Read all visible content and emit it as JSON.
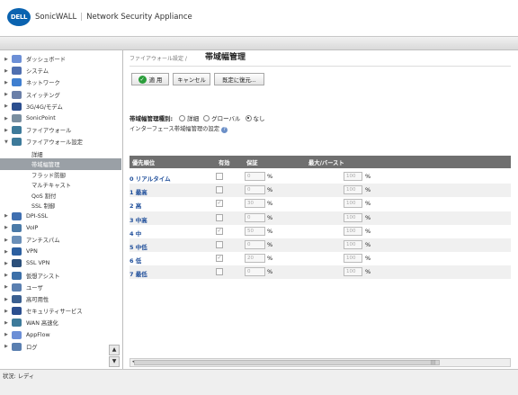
{
  "header": {
    "brand_name": "SonicWALL",
    "product_name": "Network Security Appliance",
    "logo_text": "DELL"
  },
  "sidebar": {
    "items": [
      {
        "label": "ダッシュボード",
        "icon": "dashboard-icon"
      },
      {
        "label": "システム",
        "icon": "system-icon"
      },
      {
        "label": "ネットワーク",
        "icon": "network-icon"
      },
      {
        "label": "スイッチング",
        "icon": "switching-icon"
      },
      {
        "label": "3G/4G/モデム",
        "icon": "modem-icon"
      },
      {
        "label": "SonicPoint",
        "icon": "sonicpoint-icon"
      },
      {
        "label": "ファイアウォール",
        "icon": "firewall-icon"
      },
      {
        "label": "ファイアウォール設定",
        "icon": "firewall-settings-icon"
      }
    ],
    "subitems": [
      "詳細",
      "帯域幅管理",
      "フラッド防御",
      "マルチキャスト",
      "QoS 割付",
      "SSL 制御"
    ],
    "items_after": [
      {
        "label": "DPI-SSL",
        "icon": "dpi-ssl-icon"
      },
      {
        "label": "VoIP",
        "icon": "voip-icon"
      },
      {
        "label": "アンチスパム",
        "icon": "antispam-icon"
      },
      {
        "label": "VPN",
        "icon": "vpn-icon"
      },
      {
        "label": "SSL VPN",
        "icon": "ssl-vpn-icon"
      },
      {
        "label": "仮想アシスト",
        "icon": "virtual-assist-icon"
      },
      {
        "label": "ユーザ",
        "icon": "users-icon"
      },
      {
        "label": "高可用性",
        "icon": "high-availability-icon"
      },
      {
        "label": "セキュリティサービス",
        "icon": "security-services-icon"
      },
      {
        "label": "WAN 高速化",
        "icon": "wan-acceleration-icon"
      },
      {
        "label": "AppFlow",
        "icon": "appflow-icon"
      },
      {
        "label": "ログ",
        "icon": "log-icon"
      }
    ]
  },
  "main": {
    "breadcrumb": "ファイアウォール設定 /",
    "title": "帯域幅管理",
    "buttons": {
      "apply": "適 用",
      "cancel": "キャンセル",
      "restore": "既定に復元..."
    },
    "bandwidth_type": {
      "label": "帯域幅管理種別:",
      "options": [
        "詳細",
        "グローバル",
        "なし"
      ],
      "selected": "なし"
    },
    "interface_link": "インターフェース帯域幅管理の設定",
    "table": {
      "headers": {
        "priority": "優先順位",
        "enabled": "有効",
        "guaranteed": "保証",
        "max_burst": "最大/バースト"
      },
      "rows": [
        {
          "label": "0 リアルタイム",
          "enabled": false,
          "guaranteed": "0",
          "max": "100"
        },
        {
          "label": "1 最高",
          "enabled": false,
          "guaranteed": "0",
          "max": "100"
        },
        {
          "label": "2 高",
          "enabled": true,
          "guaranteed": "30",
          "max": "100"
        },
        {
          "label": "3 中高",
          "enabled": false,
          "guaranteed": "0",
          "max": "100"
        },
        {
          "label": "4 中",
          "enabled": true,
          "guaranteed": "50",
          "max": "100"
        },
        {
          "label": "5 中低",
          "enabled": false,
          "guaranteed": "0",
          "max": "100"
        },
        {
          "label": "6 低",
          "enabled": true,
          "guaranteed": "20",
          "max": "100"
        },
        {
          "label": "7 最低",
          "enabled": false,
          "guaranteed": "0",
          "max": "100"
        }
      ],
      "percent": "%"
    }
  },
  "status": {
    "text": "状況: レディ"
  },
  "colors": {
    "brand": "#0a63b0",
    "table_header": "#6f6f6f",
    "active_nav": "#9aa0a6",
    "link": "#1f4e9a"
  }
}
